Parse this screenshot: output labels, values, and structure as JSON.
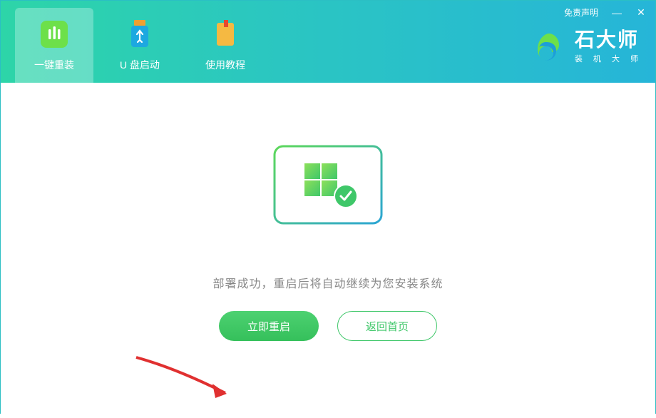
{
  "header": {
    "tabs": [
      {
        "label": "一键重装",
        "icon": "bars-icon"
      },
      {
        "label": "U 盘启动",
        "icon": "usb-icon"
      },
      {
        "label": "使用教程",
        "icon": "book-icon"
      }
    ],
    "disclaimer": "免责声明",
    "brand_title": "石大师",
    "brand_sub": "装 机 大 师"
  },
  "main": {
    "status_text": "部署成功，重启后将自动继续为您安装系统",
    "restart_label": "立即重启",
    "home_label": "返回首页"
  }
}
